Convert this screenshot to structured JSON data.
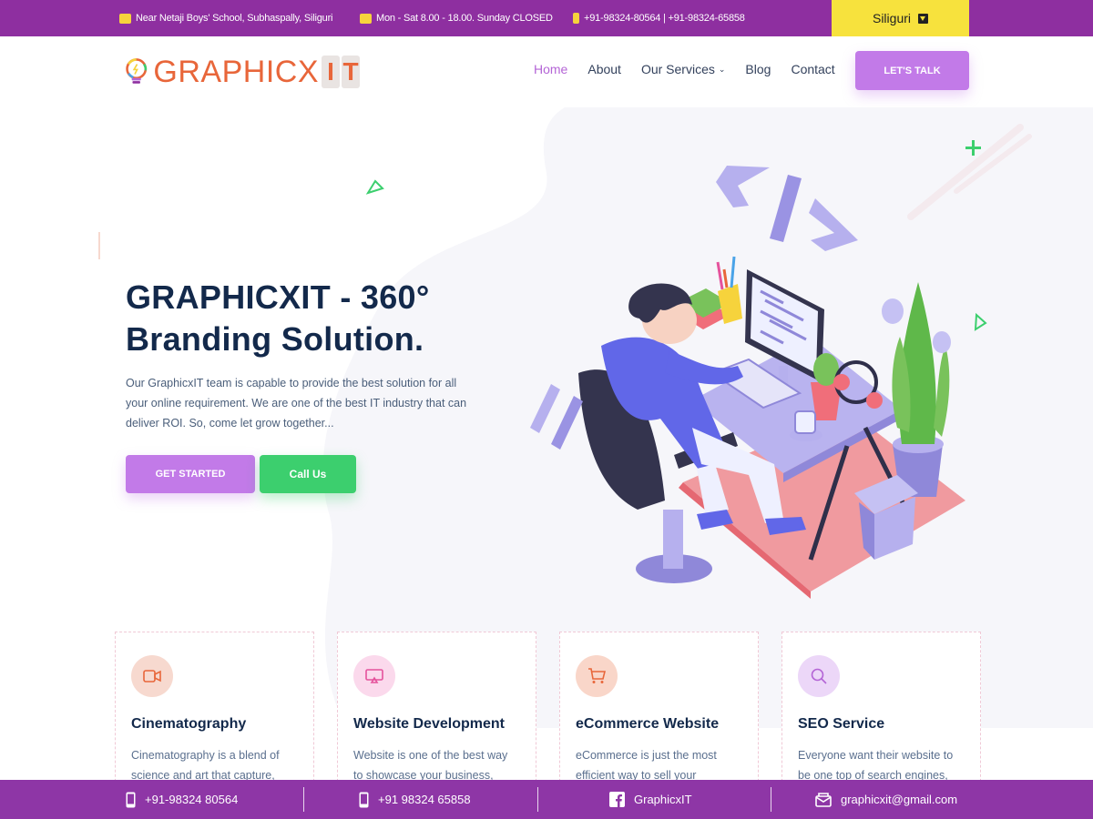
{
  "topbar": {
    "address": "Near Netaji Boys' School, Subhaspally, Siliguri",
    "hours": "Mon - Sat 8.00 - 18.00. Sunday CLOSED",
    "phones": "+91-98324-80564 | +91-98324-65858",
    "city": "Siliguri"
  },
  "header": {
    "logo_text": "GRAPHICX",
    "logo_it": [
      "I",
      "T"
    ],
    "nav": [
      {
        "label": "Home",
        "active": true
      },
      {
        "label": "About",
        "active": false
      },
      {
        "label": "Our Services",
        "active": false,
        "dropdown": true
      },
      {
        "label": "Blog",
        "active": false
      },
      {
        "label": "Contact",
        "active": false
      }
    ],
    "cta": "LET'S TALK"
  },
  "hero": {
    "title_line1": "GRAPHICXIT - 360°",
    "title_line2": "Branding Solution.",
    "text": "Our GraphicxIT team is capable to provide the best solution for all your online requirement. We are one of the best IT industry that can deliver ROI. So, come let grow together...",
    "get_started": "GET STARTED",
    "call_us": "Call Us"
  },
  "services": [
    {
      "icon": "video-camera-icon",
      "title": "Cinematography",
      "desc": "Cinematography is a blend of science and art that capture,",
      "color": "#f7d9cf",
      "icon_color": "#e8663a"
    },
    {
      "icon": "monitor-icon",
      "title": "Website Development",
      "desc": "Website is one of the best way to showcase your business,",
      "color": "#fbd9ec",
      "icon_color": "#e5529c"
    },
    {
      "icon": "cart-icon",
      "title": "eCommerce Website",
      "desc": "eCommerce is just the most efficient way to sell your",
      "color": "#f9d6c9",
      "icon_color": "#e8663a"
    },
    {
      "icon": "search-icon",
      "title": "SEO Service",
      "desc": "Everyone want their website to be one top of search engines,",
      "color": "#ecd7f8",
      "icon_color": "#b465d6"
    }
  ],
  "bottombar": {
    "phone1": "+91-98324 80564",
    "phone2": "+91 98324 65858",
    "facebook": "GraphicxIT",
    "email": "graphicxit@gmail.com"
  },
  "colors": {
    "purple_bar": "#8e2fa0",
    "accent_purple": "#c27ae8",
    "green": "#3ccf6e",
    "yellow": "#f7e23d",
    "navy": "#13294b",
    "orange": "#e8663a"
  }
}
